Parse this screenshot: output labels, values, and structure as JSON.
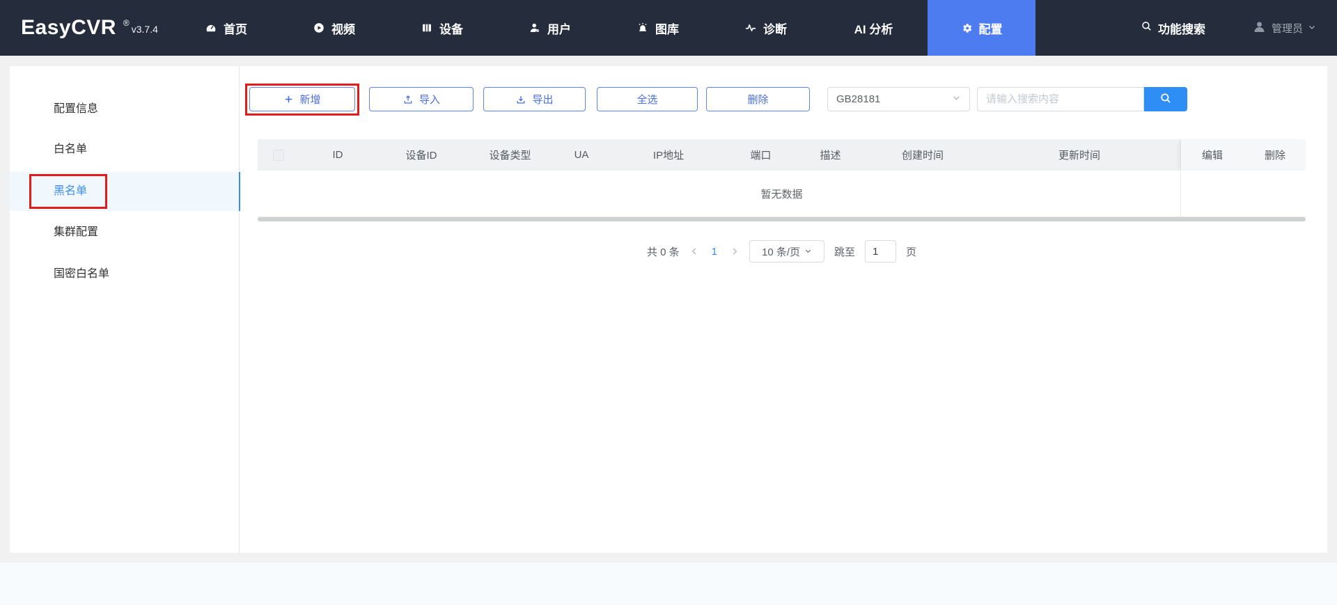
{
  "navbar": {
    "logo": "EasyCVR",
    "reg_mark": "®",
    "version": "v3.7.4",
    "items": [
      {
        "label": "首页",
        "icon": "dashboard-icon",
        "active": false
      },
      {
        "label": "视频",
        "icon": "video-icon",
        "active": false
      },
      {
        "label": "设备",
        "icon": "device-icon",
        "active": false
      },
      {
        "label": "用户",
        "icon": "user-icon",
        "active": false
      },
      {
        "label": "图库",
        "icon": "gallery-icon",
        "active": false
      },
      {
        "label": "诊断",
        "icon": "diagnosis-icon",
        "active": false
      },
      {
        "label": "AI 分析",
        "icon": "",
        "active": false
      },
      {
        "label": "配置",
        "icon": "gear-icon",
        "active": true
      }
    ],
    "function_search_label": "功能搜索",
    "user_label": "管理员"
  },
  "sidebar": {
    "items": [
      {
        "label": "配置信息",
        "active": false
      },
      {
        "label": "白名单",
        "active": false
      },
      {
        "label": "黑名单",
        "active": true
      },
      {
        "label": "集群配置",
        "active": false
      },
      {
        "label": "国密白名单",
        "active": false
      }
    ]
  },
  "toolbar": {
    "add_label": "新增",
    "import_label": "导入",
    "export_label": "导出",
    "select_all_label": "全选",
    "delete_label": "删除",
    "protocol_value": "GB28181",
    "search_placeholder": "请输入搜索内容"
  },
  "table": {
    "headers": [
      "ID",
      "设备ID",
      "设备类型",
      "UA",
      "IP地址",
      "端口",
      "描述",
      "创建时间",
      "更新时间"
    ],
    "fixed_headers": [
      "编辑",
      "删除"
    ],
    "empty_text": "暂无数据",
    "rows": []
  },
  "pagination": {
    "total_text": "共 0 条",
    "current_page": "1",
    "page_size_label": "10 条/页",
    "jump_label": "跳至",
    "jump_value": "1",
    "page_unit_label": "页"
  },
  "colors": {
    "navbar_bg": "#252d3c",
    "active_tab_blue": "#4c7cf0",
    "outline_button_blue": "#4a6fe3",
    "search_button_blue": "#2f8ef5",
    "sidebar_active_text": "#3b8cf8",
    "sidebar_active_bg": "#f0f8fe",
    "annotation_red": "#e21b1b",
    "page_bg": "#f1f1f2",
    "table_header_bg": "#f0f1f2"
  }
}
